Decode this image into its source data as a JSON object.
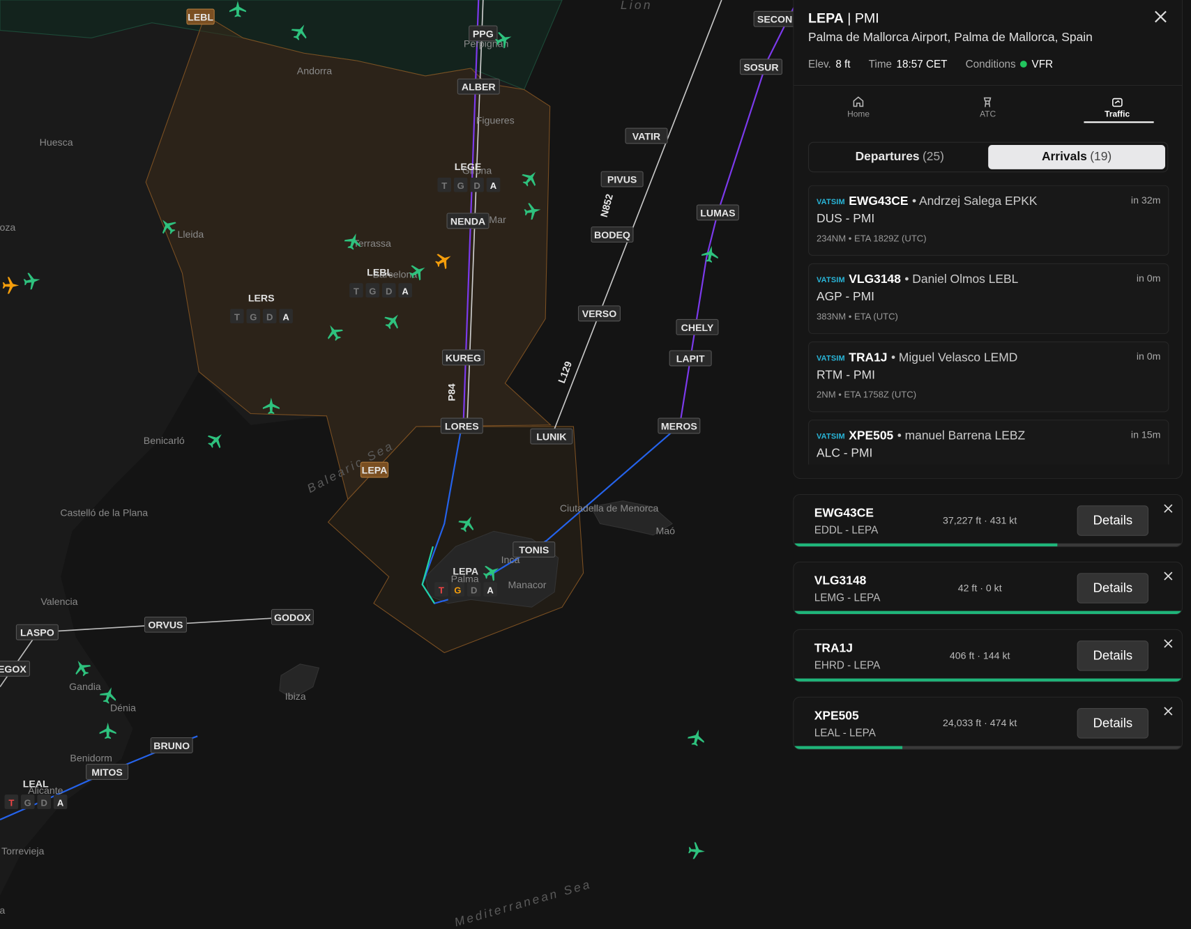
{
  "airport": {
    "icao": "LEPA",
    "iata": "PMI",
    "name": "Palma de Mallorca Airport, Palma de Mallorca, Spain",
    "elev_label": "Elev.",
    "elev": "8 ft",
    "time_label": "Time",
    "time": "18:57 CET",
    "cond_label": "Conditions",
    "cond": "VFR",
    "cond_color": "#22c55e"
  },
  "tabs": [
    {
      "label": "Home",
      "icon": "home-icon"
    },
    {
      "label": "ATC",
      "icon": "tower-icon"
    },
    {
      "label": "Traffic",
      "icon": "traffic-icon"
    }
  ],
  "segment": {
    "departures": "Departures",
    "departures_count": "(25)",
    "arrivals": "Arrivals",
    "arrivals_count": "(19)"
  },
  "arrivals": [
    {
      "network": "VATSIM",
      "callsign": "EWG43CE",
      "pilot": "Andrzej Salega EPKK",
      "route": "DUS - PMI",
      "info": "234NM • ETA 1829Z (UTC)",
      "eta": "in 32m"
    },
    {
      "network": "VATSIM",
      "callsign": "VLG3148",
      "pilot": "Daniel Olmos LEBL",
      "route": "AGP - PMI",
      "info": "383NM • ETA (UTC)",
      "eta": "in 0m"
    },
    {
      "network": "VATSIM",
      "callsign": "TRA1J",
      "pilot": "Miguel Velasco LEMD",
      "route": "RTM - PMI",
      "info": "2NM • ETA 1758Z (UTC)",
      "eta": "in 0m"
    },
    {
      "network": "VATSIM",
      "callsign": "XPE505",
      "pilot": "manuel Barrena LEBZ",
      "route": "ALC - PMI",
      "info": "",
      "eta": "in 15m"
    }
  ],
  "flights": [
    {
      "callsign": "EWG43CE",
      "route": "EDDL - LEPA",
      "status": "37,227 ft · 431 kt",
      "details": "Details",
      "progress": 0.68
    },
    {
      "callsign": "VLG3148",
      "route": "LEMG - LEPA",
      "status": "42 ft · 0 kt",
      "details": "Details",
      "progress": 1.0
    },
    {
      "callsign": "TRA1J",
      "route": "EHRD - LEPA",
      "status": "406 ft · 144 kt",
      "details": "Details",
      "progress": 1.0
    },
    {
      "callsign": "XPE505",
      "route": "LEAL - LEPA",
      "status": "24,033 ft · 474 kt",
      "details": "Details",
      "progress": 0.28
    }
  ],
  "map": {
    "waypoints": [
      "PPG",
      "ALBER",
      "SECON",
      "SOSUR",
      "VATIR",
      "PIVUS",
      "BODEQ",
      "NENDA",
      "LUMAS",
      "VERSO",
      "CHELY",
      "LAPIT",
      "KUREG",
      "LORES",
      "LUNIK",
      "MEROS",
      "TONIS",
      "ORVUS",
      "GODOX",
      "LASPO",
      "EGOX",
      "BRUNO",
      "MITOS"
    ],
    "airways": [
      "N852",
      "L129",
      "P84"
    ],
    "airports": [
      "LEGE",
      "LEBL",
      "LERS",
      "LEPA",
      "LEAL"
    ],
    "fir_tags": [
      "LEBL",
      "LEPA"
    ],
    "atc_letters": [
      "T",
      "G",
      "D",
      "A"
    ],
    "cities": [
      "Andorra",
      "Perpignan",
      "Figueres",
      "Huesca",
      "Lleida",
      "Girona",
      "Mar",
      "Terrassa",
      "Barcelona",
      "Benicarló",
      "Castelló de la Plana",
      "Valencia",
      "Gandia",
      "Dénia",
      "Benidorm",
      "Alicante",
      "Torrevieja",
      "Ibiza",
      "Palma",
      "Inca",
      "Manacor",
      "Ciutadella de Menorca",
      "Maó",
      "oza",
      "a"
    ],
    "seas": [
      "Balearic Sea",
      "Mediterranean Sea",
      "Lion"
    ]
  }
}
